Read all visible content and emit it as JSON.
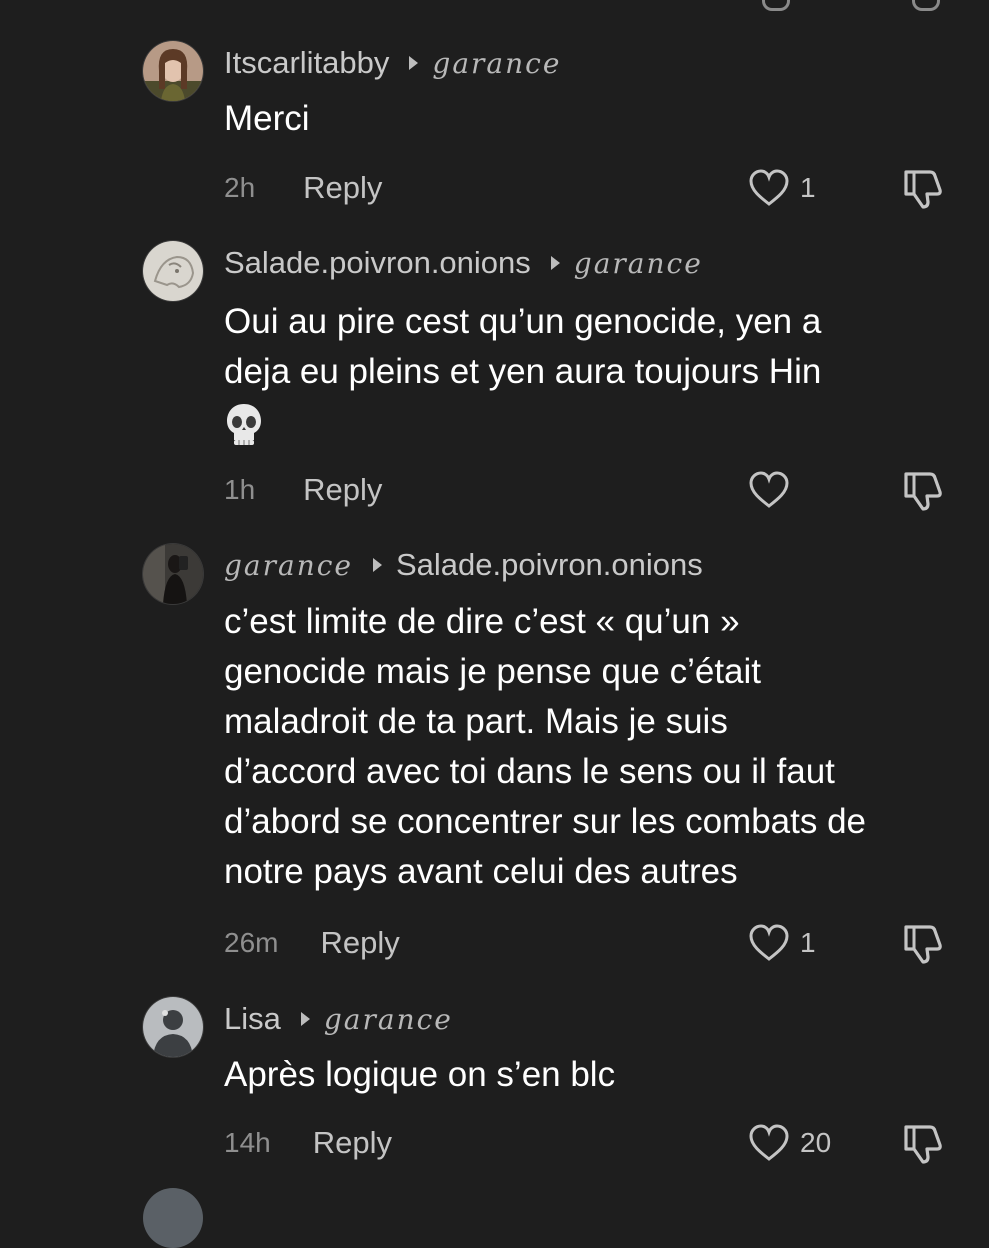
{
  "comments": [
    {
      "username": "Itscarlitabby",
      "reply_to": "garance",
      "lines": [
        "Merci"
      ],
      "time": "2h",
      "reply_label": "Reply",
      "likes": "1",
      "avatar": "user-photo-avatar"
    },
    {
      "username": "Salade.poivron.onions",
      "reply_to": "garance",
      "lines": [
        "Oui au pire cest qu’un genocide, yen a",
        "deja eu pleins et yen aura toujours Hin"
      ],
      "emoji": "💀",
      "time": "1h",
      "reply_label": "Reply",
      "likes": "",
      "avatar": "sketch-avatar"
    },
    {
      "username": "garance",
      "reply_to": "Salade.poivron.onions",
      "lines": [
        "c’est limite de dire c’est « qu’un »",
        "genocide mais je pense que c’était",
        "maladroit de ta part. Mais je suis",
        "d’accord avec toi dans le sens ou il faut",
        "d’abord se concentrer sur les combats de",
        "notre pays avant celui des autres"
      ],
      "time": "26m",
      "reply_label": "Reply",
      "likes": "1",
      "avatar": "dark-photo-avatar"
    },
    {
      "username": "Lisa",
      "reply_to": "garance",
      "lines": [
        "Après logique on s’en blc"
      ],
      "time": "14h",
      "reply_label": "Reply",
      "likes": "20",
      "avatar": "default-avatar"
    }
  ],
  "icons": {
    "like": "heart-outline-icon",
    "dislike": "thumbs-down-icon",
    "arrow": "reply-arrow-icon"
  },
  "colors": {
    "background": "#1e1e1e",
    "text": "#ffffff",
    "secondary": "#8f8f8f",
    "username": "#c9c9c9"
  }
}
